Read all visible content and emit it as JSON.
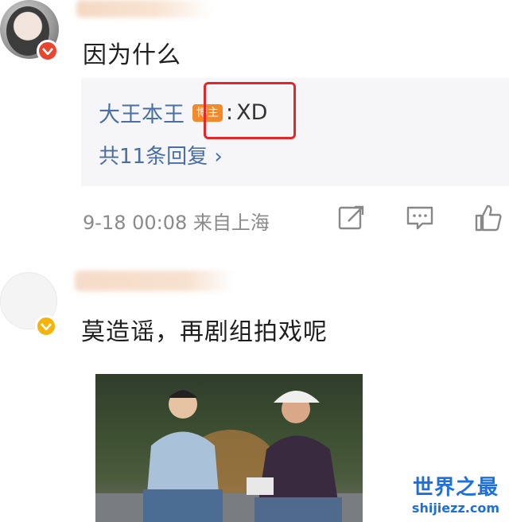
{
  "comments": [
    {
      "text": "因为什么",
      "reply": {
        "user": "大王本王",
        "badge": "博主",
        "separator": ":",
        "text": "XD",
        "count_label": "共11条回复 ›"
      },
      "meta": "9-18 00:08 来自上海",
      "actions": [
        "share-icon",
        "comment-icon",
        "like-icon"
      ]
    },
    {
      "text": "莫造谣，再剧组拍戏呢"
    }
  ],
  "watermark": {
    "title": "世界之最",
    "url": "shijiezz.com"
  },
  "colors": {
    "link": "#4a6fa5",
    "badge": "#f08a2c",
    "highlight": "#e0272a",
    "watermark": "#1e6fd9"
  }
}
